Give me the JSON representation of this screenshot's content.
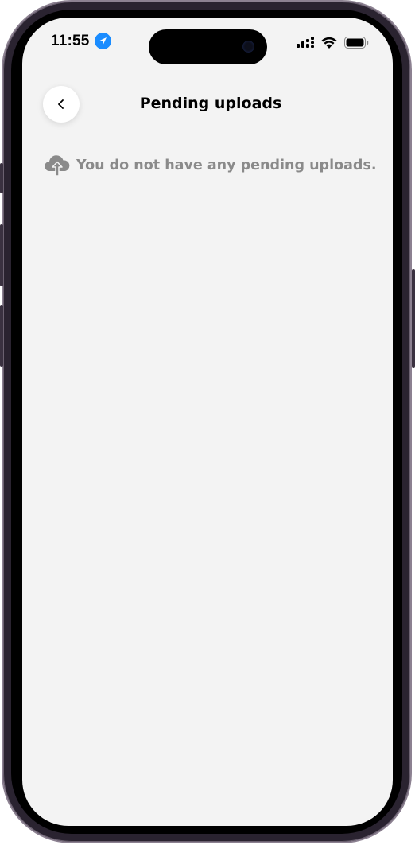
{
  "status_bar": {
    "time": "11:55",
    "location_icon": "location-arrow-icon",
    "signal_icon": "cellular-signal-icon",
    "wifi_icon": "wifi-icon",
    "battery_icon": "battery-icon"
  },
  "header": {
    "back_icon": "chevron-left-icon",
    "title": "Pending uploads"
  },
  "empty_state": {
    "icon": "cloud-upload-icon",
    "message": "You do not have any pending uploads."
  },
  "colors": {
    "screen_background": "#f3f3f3",
    "location_accent": "#1a8cff",
    "muted_text": "#8a8a8a"
  }
}
